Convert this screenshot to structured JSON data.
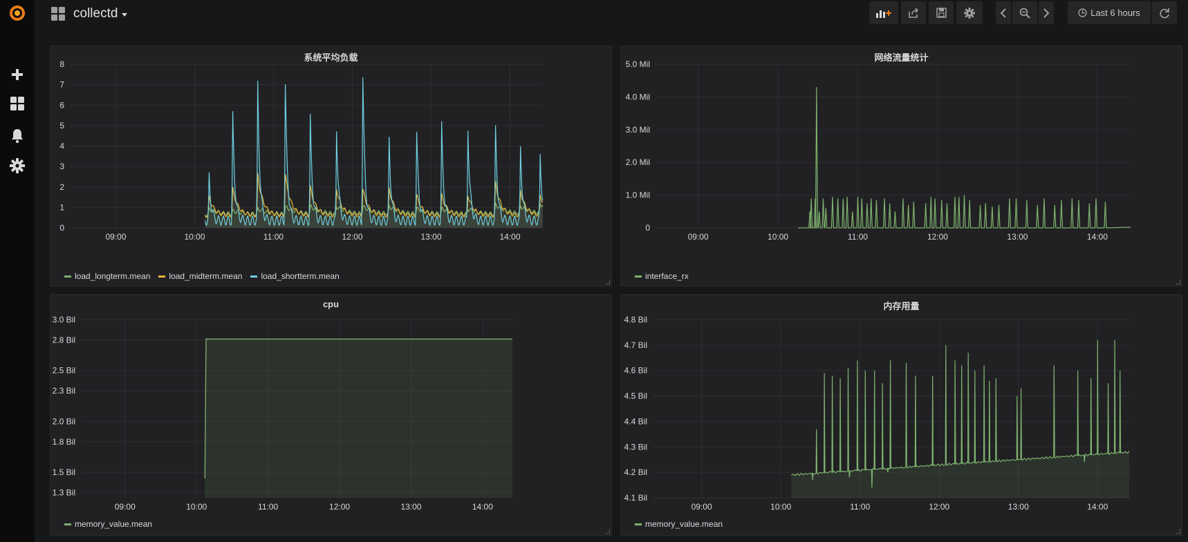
{
  "dashboard": {
    "title": "collectd"
  },
  "time_picker": {
    "label": "Last 6 hours"
  },
  "icons": {
    "logo": "grafana-logo-icon",
    "create": "plus-icon",
    "dashboards": "dashboards-grid-icon",
    "alerting": "bell-icon",
    "configuration": "gear-icon",
    "add_panel": "add-panel-icon",
    "share": "share-icon",
    "save": "save-icon",
    "settings": "gear-icon",
    "back": "chevron-left-icon",
    "zoom": "zoom-out-icon",
    "forward": "chevron-right-icon",
    "clock": "clock-icon",
    "refresh": "refresh-icon"
  },
  "colors": {
    "green": "#7eb26d",
    "yellow": "#eab839",
    "blue": "#6ed0e0",
    "accent": "#eb7b18"
  },
  "panels": {
    "load": {
      "title": "系统平均负载",
      "legend": [
        "load_longterm.mean",
        "load_midterm.mean",
        "load_shortterm.mean"
      ]
    },
    "network": {
      "title": "网络流量统计",
      "legend": [
        "interface_rx"
      ]
    },
    "cpu": {
      "title": "cpu",
      "legend": [
        "memory_value.mean"
      ]
    },
    "memory": {
      "title": "内存用量",
      "legend": [
        "memory_value.mean"
      ]
    }
  },
  "chart_data": [
    {
      "type": "line",
      "title": "系统平均负载",
      "x_ticks": [
        "09:00",
        "10:00",
        "11:00",
        "12:00",
        "13:00",
        "14:00"
      ],
      "xlim": [
        "08:25",
        "14:25"
      ],
      "y_ticks": [
        "0",
        "1",
        "2",
        "3",
        "4",
        "5",
        "6",
        "7",
        "8"
      ],
      "ylim": [
        0,
        8
      ],
      "grid": true,
      "legend_position": "bottom-left",
      "data_start": "10:08",
      "spike_times": [
        "10:11",
        "10:29",
        "10:48",
        "11:09",
        "11:28",
        "11:48",
        "12:08",
        "12:28",
        "12:49",
        "13:08",
        "13:28",
        "13:49",
        "14:08",
        "14:23"
      ],
      "series": [
        {
          "name": "load_longterm.mean",
          "color": "#7eb26d",
          "baseline": 0.65,
          "spike_heights": [
            0.9,
            0.8,
            0.9,
            1.0,
            1.0,
            1.0,
            1.0,
            1.0,
            0.9,
            0.9,
            0.9,
            1.1,
            1.0,
            1.1
          ]
        },
        {
          "name": "load_midterm.mean",
          "color": "#eab839",
          "baseline": 0.6,
          "spike_heights": [
            1.5,
            1.9,
            2.6,
            2.6,
            2.0,
            1.9,
            1.9,
            1.9,
            1.6,
            1.6,
            1.6,
            2.2,
            1.8,
            1.6
          ]
        },
        {
          "name": "load_shortterm.mean",
          "color": "#6ed0e0",
          "baseline": 0.35,
          "spike_heights": [
            2.5,
            5.5,
            7.0,
            7.0,
            5.4,
            4.8,
            7.4,
            4.3,
            4.6,
            5.0,
            4.9,
            4.8,
            3.9,
            3.6
          ]
        }
      ]
    },
    {
      "type": "line",
      "title": "网络流量统计",
      "x_ticks": [
        "09:00",
        "10:00",
        "11:00",
        "12:00",
        "13:00",
        "14:00"
      ],
      "xlim": [
        "08:28",
        "14:25"
      ],
      "y_ticks": [
        "0",
        "1.0 Mil",
        "2.0 Mil",
        "3.0 Mil",
        "4.0 Mil",
        "5.0 Mil"
      ],
      "ylim": [
        0,
        5000000
      ],
      "grid": true,
      "legend_position": "bottom-left",
      "series": [
        {
          "name": "interface_rx",
          "color": "#7eb26d",
          "spikes": [
            [
              "10:24",
              0.5
            ],
            [
              "10:25",
              0.9
            ],
            [
              "10:28",
              0.9
            ],
            [
              "10:29",
              4.3
            ],
            [
              "10:31",
              0.5
            ],
            [
              "10:34",
              0.9
            ],
            [
              "10:36",
              0.6
            ],
            [
              "10:41",
              0.95
            ],
            [
              "10:45",
              0.9
            ],
            [
              "10:49",
              0.9
            ],
            [
              "10:52",
              0.95
            ],
            [
              "10:56",
              0.5
            ],
            [
              "11:00",
              0.95
            ],
            [
              "11:03",
              0.9
            ],
            [
              "11:07",
              0.75
            ],
            [
              "11:10",
              0.9
            ],
            [
              "11:14",
              0.85
            ],
            [
              "11:20",
              0.9
            ],
            [
              "11:24",
              0.75
            ],
            [
              "11:28",
              0.5
            ],
            [
              "11:34",
              0.9
            ],
            [
              "11:38",
              0.7
            ],
            [
              "11:42",
              0.8
            ],
            [
              "11:51",
              0.75
            ],
            [
              "11:55",
              0.95
            ],
            [
              "11:58",
              0.9
            ],
            [
              "12:03",
              0.85
            ],
            [
              "12:07",
              0.75
            ],
            [
              "12:13",
              0.95
            ],
            [
              "12:16",
              0.95
            ],
            [
              "12:20",
              1.0
            ],
            [
              "12:24",
              0.85
            ],
            [
              "12:32",
              0.7
            ],
            [
              "12:36",
              0.75
            ],
            [
              "12:41",
              0.65
            ],
            [
              "12:46",
              0.7
            ],
            [
              "12:54",
              0.9
            ],
            [
              "12:59",
              0.9
            ],
            [
              "13:07",
              0.85
            ],
            [
              "13:15",
              0.7
            ],
            [
              "13:20",
              0.9
            ],
            [
              "13:28",
              0.7
            ],
            [
              "13:33",
              0.85
            ],
            [
              "13:41",
              0.9
            ],
            [
              "13:46",
              0.85
            ],
            [
              "13:54",
              0.75
            ],
            [
              "13:59",
              0.9
            ],
            [
              "14:06",
              0.8
            ]
          ]
        }
      ]
    },
    {
      "type": "area",
      "title": "cpu",
      "x_ticks": [
        "09:00",
        "10:00",
        "11:00",
        "12:00",
        "13:00",
        "14:00"
      ],
      "xlim": [
        "08:23",
        "14:25"
      ],
      "y_ticks": [
        "1.3 Bil",
        "1.5 Bil",
        "1.8 Bil",
        "2.0 Bil",
        "2.3 Bil",
        "2.5 Bil",
        "2.8 Bil",
        "3.0 Bil"
      ],
      "ylim": [
        1250000000,
        3000000000
      ],
      "grid": true,
      "legend_position": "bottom-left",
      "series": [
        {
          "name": "memory_value.mean",
          "color": "#7eb26d",
          "points": [
            [
              "10:07",
              1.44
            ],
            [
              "10:08",
              2.81
            ],
            [
              "14:25",
              2.81
            ]
          ]
        }
      ]
    },
    {
      "type": "area",
      "title": "内存用量",
      "x_ticks": [
        "09:00",
        "10:00",
        "11:00",
        "12:00",
        "13:00",
        "14:00"
      ],
      "xlim": [
        "08:23",
        "14:25"
      ],
      "y_ticks": [
        "4.1 Bil",
        "4.2 Bil",
        "4.3 Bil",
        "4.4 Bil",
        "4.5 Bil",
        "4.6 Bil",
        "4.7 Bil",
        "4.8 Bil"
      ],
      "ylim": [
        4100000000,
        4800000000
      ],
      "grid": true,
      "legend_position": "bottom-left",
      "baseline": {
        "start": [
          "10:08",
          4.19
        ],
        "end": [
          "14:25",
          4.28
        ]
      },
      "series": [
        {
          "name": "memory_value.mean",
          "color": "#7eb26d",
          "spikes": [
            [
              "10:27",
              4.37
            ],
            [
              "10:33",
              4.59
            ],
            [
              "10:39",
              4.58
            ],
            [
              "10:45",
              4.57
            ],
            [
              "10:51",
              4.61
            ],
            [
              "10:58",
              4.64
            ],
            [
              "11:04",
              4.6
            ],
            [
              "11:11",
              4.6
            ],
            [
              "11:17",
              4.55
            ],
            [
              "11:23",
              4.64
            ],
            [
              "11:35",
              4.63
            ],
            [
              "11:42",
              4.58
            ],
            [
              "11:55",
              4.58
            ],
            [
              "12:05",
              4.7
            ],
            [
              "12:12",
              4.64
            ],
            [
              "12:17",
              4.62
            ],
            [
              "12:22",
              4.67
            ],
            [
              "12:27",
              4.6
            ],
            [
              "12:34",
              4.62
            ],
            [
              "12:38",
              4.56
            ],
            [
              "12:43",
              4.57
            ],
            [
              "12:59",
              4.5
            ],
            [
              "13:02",
              4.53
            ],
            [
              "13:27",
              4.62
            ],
            [
              "13:45",
              4.6
            ],
            [
              "13:55",
              4.57
            ],
            [
              "14:00",
              4.72
            ],
            [
              "14:08",
              4.55
            ],
            [
              "14:13",
              4.72
            ],
            [
              "14:17",
              4.6
            ]
          ],
          "dips": [
            [
              "10:24",
              4.17
            ],
            [
              "10:52",
              4.18
            ],
            [
              "11:09",
              4.14
            ],
            [
              "11:21",
              4.2
            ],
            [
              "13:50",
              4.24
            ]
          ]
        }
      ]
    }
  ]
}
